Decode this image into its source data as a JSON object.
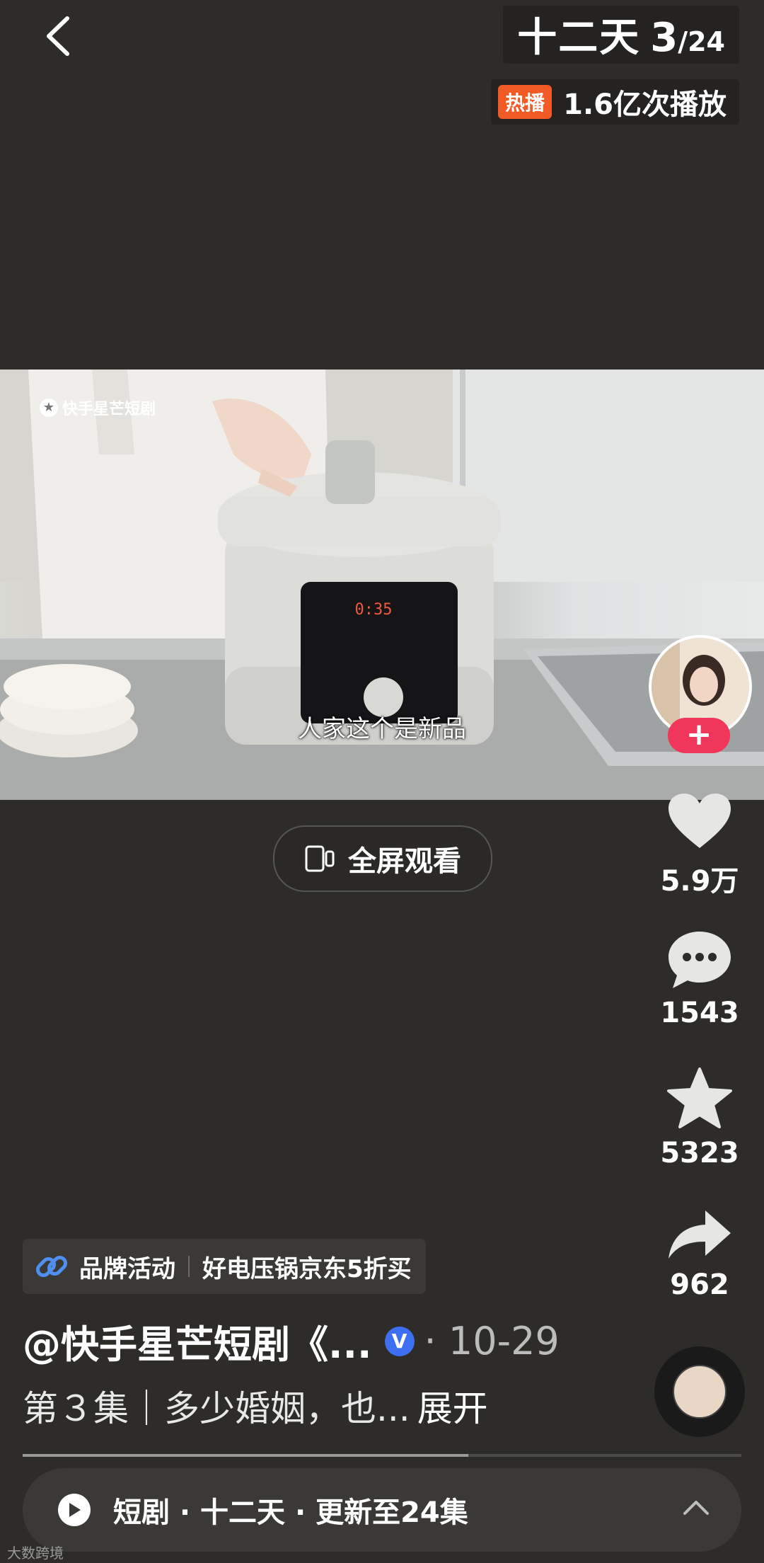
{
  "header": {
    "back_icon": "chevron-left-icon",
    "drama_title": "十二天",
    "episode_current": "3",
    "episode_total": "/24",
    "hot_badge": "热播",
    "play_count": "1.6亿次播放"
  },
  "video": {
    "watermark": "快手星芒短剧",
    "subtitle": "人家这个是新品"
  },
  "fullscreen": {
    "label": "全屏观看",
    "icon": "fullscreen-icon"
  },
  "rail": {
    "follow_label": "+",
    "like_count": "5.9万",
    "comment_count": "1543",
    "star_count": "5323",
    "share_count": "962"
  },
  "bottom": {
    "brand_label": "品牌活动",
    "brand_promo": "好电压锅京东5折买",
    "author": "@快手星芒短剧《...",
    "verified": "V",
    "separator_date": "· 10-29",
    "description": "第３集｜多少婚姻，也...",
    "expand": "展开",
    "progress_fraction": 0.62
  },
  "bar": {
    "text": "短剧 · 十二天 · 更新至24集"
  },
  "footer": {
    "mark": "大数跨境"
  },
  "colors": {
    "accent_red": "#f0365a",
    "hot_orange": "#f15a24",
    "verified_blue": "#3d6ff0",
    "background": "#2d2c29"
  }
}
